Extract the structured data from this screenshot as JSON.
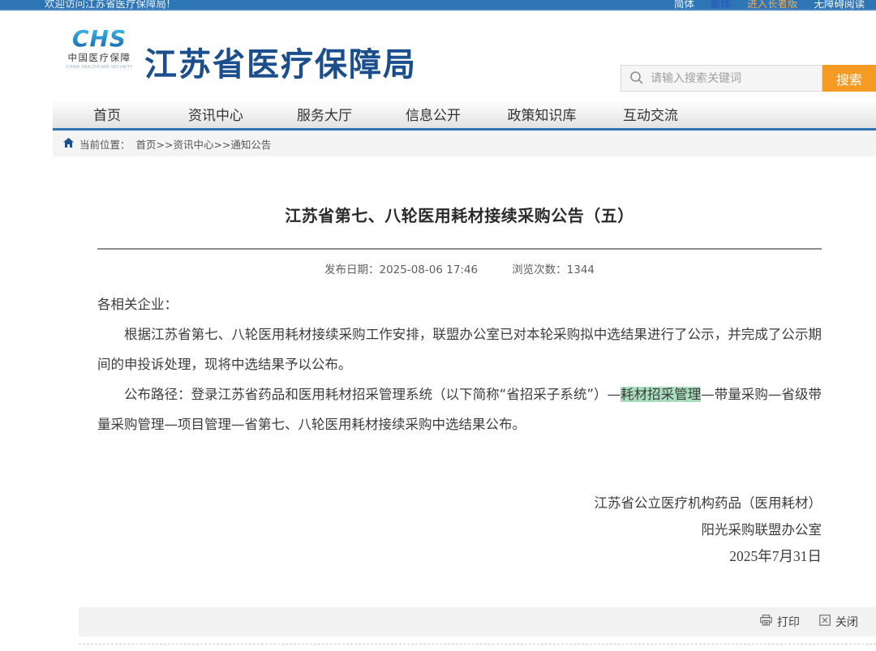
{
  "topbar": {
    "welcome": "欢迎访问江苏省医疗保障局!",
    "links": [
      {
        "label": "简体",
        "color": "#f4f9ff"
      },
      {
        "label": "繁体",
        "color": "#2457b8"
      },
      {
        "label": "进入长者版",
        "color": "#f0a94f"
      },
      {
        "label": "无障碍阅读",
        "color": "#f4f9ff"
      }
    ]
  },
  "header": {
    "logo": {
      "acronym": "CHS",
      "cn": "中国医疗保障",
      "en": "CHINA HEALTHCARE SECURITY"
    },
    "site_title": "江苏省医疗保障局",
    "search": {
      "placeholder": "请输入搜索关键词",
      "button": "搜索"
    }
  },
  "nav": {
    "items": [
      "首页",
      "资讯中心",
      "服务大厅",
      "信息公开",
      "政策知识库",
      "互动交流"
    ]
  },
  "breadcrumb": {
    "prefix": "当前位置：",
    "path": "首页>>资讯中心>>通知公告"
  },
  "article": {
    "title": "江苏省第七、八轮医用耗材接续采购公告（五）",
    "publish_label": "发布日期：",
    "publish_value": "2025-08-06 17:46",
    "views_label": "浏览次数：",
    "views_value": "1344",
    "salutation": "各相关企业：",
    "para1": "根据江苏省第七、八轮医用耗材接续采购工作安排，联盟办公室已对本轮采购拟中选结果进行了公示，并完成了公示期间的申投诉处理，现将中选结果予以公布。",
    "para2_before": "公布路径：登录江苏省药品和医用耗材招采管理系统（以下简称“省招采子系统”）—",
    "para2_highlight": "耗材招采管理",
    "para2_after": "—带量采购—省级带量采购管理—项目管理—省第七、八轮医用耗材接续采购中选结果公布。",
    "sign1": "江苏省公立医疗机构药品（医用耗材）",
    "sign2": "阳光采购联盟办公室",
    "sign_date": "2025年7月31日"
  },
  "tools": {
    "print": "打印",
    "close": "关闭"
  },
  "icons": {
    "search": "magnifier",
    "home": "house",
    "print": "printer",
    "close": "boxed-x"
  },
  "colors": {
    "topbar_blue": "#2e75b6",
    "brand_blue": "#1a4e8c",
    "nav_border_blue": "#2e74b5",
    "search_orange": "#f59a23",
    "highlight_green": "#a9dfbf",
    "logo_gradient_top": "#3db5e6",
    "logo_gradient_bottom": "#1568b0"
  }
}
